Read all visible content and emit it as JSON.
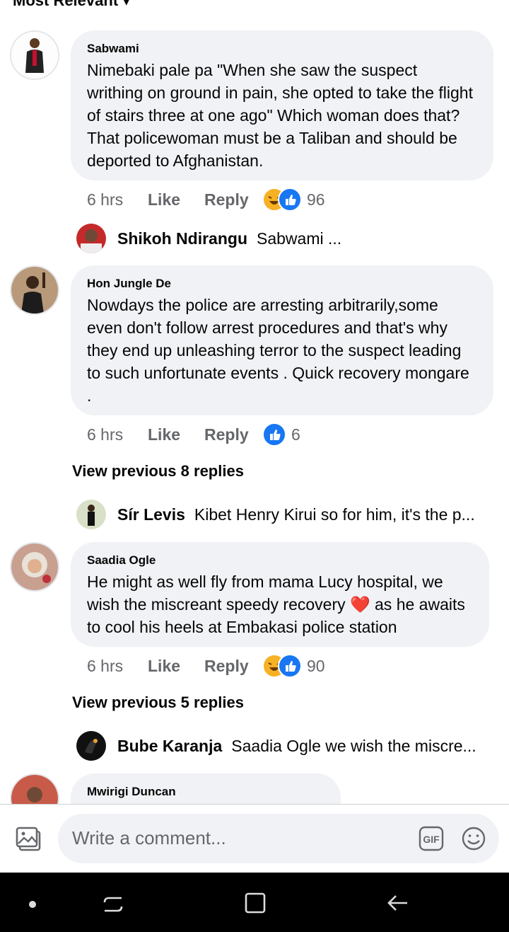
{
  "sort": {
    "label": "Most Relevant"
  },
  "comments": [
    {
      "author": "Sabwami",
      "text": "Nimebaki pale pa \"When she saw the suspect writhing on ground in pain, she opted to take the flight of stairs three at one ago\" Which woman does that? That policewoman must be a Taliban and should be deported to Afghanistan.",
      "time": "6 hrs",
      "like": "Like",
      "reply": "Reply",
      "reactions": [
        "haha",
        "like"
      ],
      "count": "96",
      "reply_preview": {
        "name": "Shikoh Ndirangu",
        "text": "Sabwami ..."
      }
    },
    {
      "author": "Hon Jungle De",
      "text": "Nowdays the police are arresting arbitrarily,some even don't follow arrest procedures and that's why they end up unleashing terror to the suspect leading to such unfortunate events . Quick recovery mongare .",
      "time": "6 hrs",
      "like": "Like",
      "reply": "Reply",
      "reactions": [
        "like"
      ],
      "count": "6",
      "view_previous": "View previous 8 replies",
      "reply_preview": {
        "name": "Sír Levis",
        "text": "Kibet Henry Kirui so for him, it's the p..."
      }
    },
    {
      "author": "Saadia Ogle",
      "text": "He might as well fly from mama Lucy hospital, we wish the miscreant speedy recovery ❤️ as he awaits to cool his heels at Embakasi police station",
      "time": "6 hrs",
      "like": "Like",
      "reply": "Reply",
      "reactions": [
        "haha",
        "like"
      ],
      "count": "90",
      "view_previous": "View previous 5 replies",
      "reply_preview": {
        "name": "Bube Karanja",
        "text": "Saadia Ogle we wish the miscre..."
      }
    },
    {
      "author": "Mwirigi Duncan"
    }
  ],
  "composer": {
    "placeholder": "Write a comment...",
    "gif_label": "GIF"
  },
  "colors": {
    "bubble": "#f0f2f5",
    "like_blue": "#1877f2",
    "haha_yellow": "#f7b125",
    "meta_gray": "#65676b"
  }
}
